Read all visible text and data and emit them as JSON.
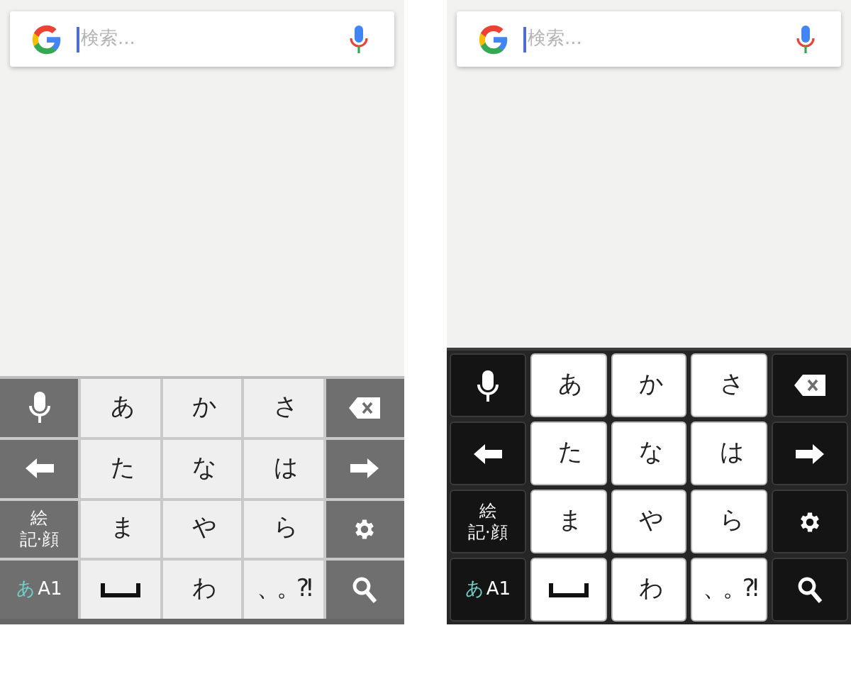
{
  "screens": [
    {
      "kind": "light",
      "search": {
        "placeholder": "検索..."
      },
      "keyboard": {
        "rows": [
          [
            {
              "kind": "icon"
            },
            {
              "kind": "char",
              "label": "あ"
            },
            {
              "kind": "char",
              "label": "か"
            },
            {
              "kind": "char",
              "label": "さ"
            },
            {
              "kind": "icon"
            }
          ],
          [
            {
              "kind": "icon"
            },
            {
              "kind": "char",
              "label": "た"
            },
            {
              "kind": "char",
              "label": "な"
            },
            {
              "kind": "char",
              "label": "は"
            },
            {
              "kind": "icon"
            }
          ],
          [
            {
              "kind": "lines",
              "lines": [
                "絵",
                "記·顔"
              ]
            },
            {
              "kind": "char",
              "label": "ま"
            },
            {
              "kind": "char",
              "label": "や"
            },
            {
              "kind": "char",
              "label": "ら"
            },
            {
              "kind": "icon"
            }
          ],
          [
            {
              "kind": "mode",
              "parts": [
                "あ",
                "A1"
              ]
            },
            {
              "kind": "icon"
            },
            {
              "kind": "char",
              "label": "わ"
            },
            {
              "kind": "char",
              "label": "、。?!"
            },
            {
              "kind": "icon"
            }
          ]
        ]
      }
    },
    {
      "kind": "dark",
      "search": {
        "placeholder": "検索..."
      },
      "keyboard": {
        "rows": [
          [
            {
              "kind": "icon"
            },
            {
              "kind": "char",
              "label": "あ"
            },
            {
              "kind": "char",
              "label": "か"
            },
            {
              "kind": "char",
              "label": "さ"
            },
            {
              "kind": "icon"
            }
          ],
          [
            {
              "kind": "icon"
            },
            {
              "kind": "char",
              "label": "た"
            },
            {
              "kind": "char",
              "label": "な"
            },
            {
              "kind": "char",
              "label": "は"
            },
            {
              "kind": "icon"
            }
          ],
          [
            {
              "kind": "lines",
              "lines": [
                "絵",
                "記·顔"
              ]
            },
            {
              "kind": "char",
              "label": "ま"
            },
            {
              "kind": "char",
              "label": "や"
            },
            {
              "kind": "char",
              "label": "ら"
            },
            {
              "kind": "icon"
            }
          ],
          [
            {
              "kind": "mode",
              "parts": [
                "あ",
                "A1"
              ]
            },
            {
              "kind": "icon"
            },
            {
              "kind": "char",
              "label": "わ"
            },
            {
              "kind": "char",
              "label": "、。?!"
            },
            {
              "kind": "icon"
            }
          ]
        ]
      }
    }
  ]
}
